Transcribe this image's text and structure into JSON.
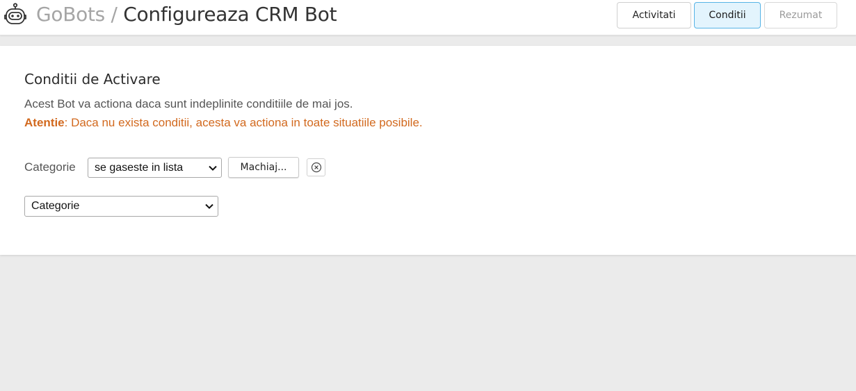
{
  "header": {
    "brand": "GoBots",
    "separator": "/",
    "page_title": "Configureaza CRM Bot",
    "logo_icon": "robot-icon"
  },
  "nav": {
    "tabs": [
      {
        "label": "Activitati",
        "state": "default"
      },
      {
        "label": "Conditii",
        "state": "active"
      },
      {
        "label": "Rezumat",
        "state": "disabled"
      }
    ]
  },
  "conditions": {
    "heading": "Conditii de Activare",
    "description": "Acest Bot va actiona daca sunt indeplinite conditiile de mai jos.",
    "warning_prefix": "Atentie",
    "warning_text": ": Daca nu exista conditii, acesta va actiona in toate situatiile posibile.",
    "rows": [
      {
        "field_label": "Categorie",
        "operator": "se gaseste in lista",
        "value_button": "Machiaj...",
        "remove_icon": "close-circle-icon"
      }
    ],
    "add_condition_select": "Categorie"
  },
  "colors": {
    "accent_active_bg": "#e3f4fd",
    "accent_active_border": "#56b3e6",
    "warning": "#d2691e",
    "page_bg": "#ebebeb"
  }
}
